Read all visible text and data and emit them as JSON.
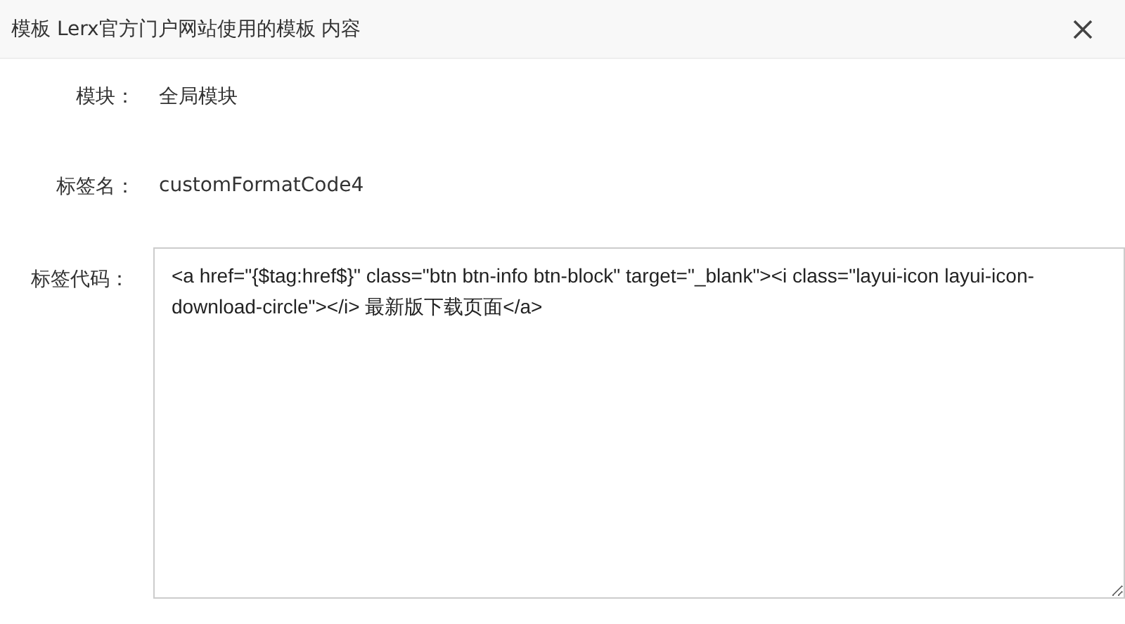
{
  "window": {
    "title": "模板 Lerx官方门户网站使用的模板 内容"
  },
  "fields": [
    {
      "kind": "text",
      "label": "模块：",
      "value": "全局模块"
    },
    {
      "kind": "text",
      "label": "标签名：",
      "value": "customFormatCode4"
    },
    {
      "kind": "textarea",
      "label": "标签代码：",
      "value": "<a href=\"{$tag:href$}\" class=\"btn btn-info btn-block\" target=\"_blank\"><i class=\"layui-icon layui-icon-download-circle\"></i> 最新版下载页面</a>"
    }
  ]
}
